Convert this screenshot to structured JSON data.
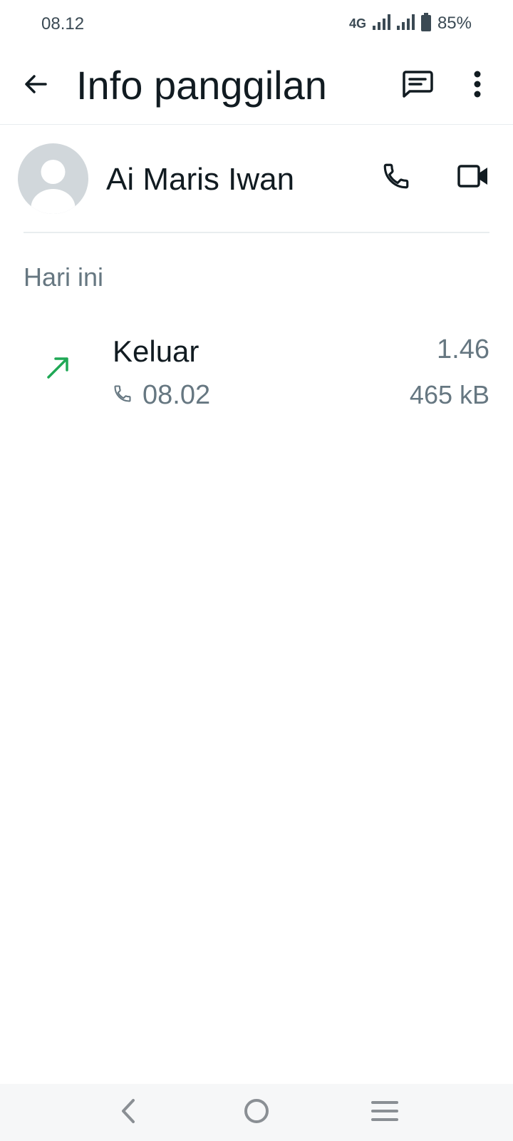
{
  "status_bar": {
    "time": "08.12",
    "network": "4G",
    "battery": "85%"
  },
  "header": {
    "title": "Info panggilan",
    "icons": [
      "back-arrow-icon",
      "message-icon",
      "more-vertical-icon"
    ]
  },
  "contact": {
    "name": "Ai Maris Iwan",
    "icons": [
      "phone-icon",
      "video-camera-icon"
    ]
  },
  "section": {
    "title": "Hari ini"
  },
  "calls": [
    {
      "type": "Keluar",
      "time": "08.02",
      "duration": "1.46",
      "data": "465 kB",
      "direction": "outgoing",
      "direction_color": "#1fa855"
    }
  ],
  "nav": {
    "icons": [
      "nav-back-icon",
      "nav-home-icon",
      "nav-recent-icon"
    ]
  },
  "colors": {
    "primary_text": "#111b21",
    "secondary_text": "#667781",
    "accent_green": "#1fa855"
  }
}
